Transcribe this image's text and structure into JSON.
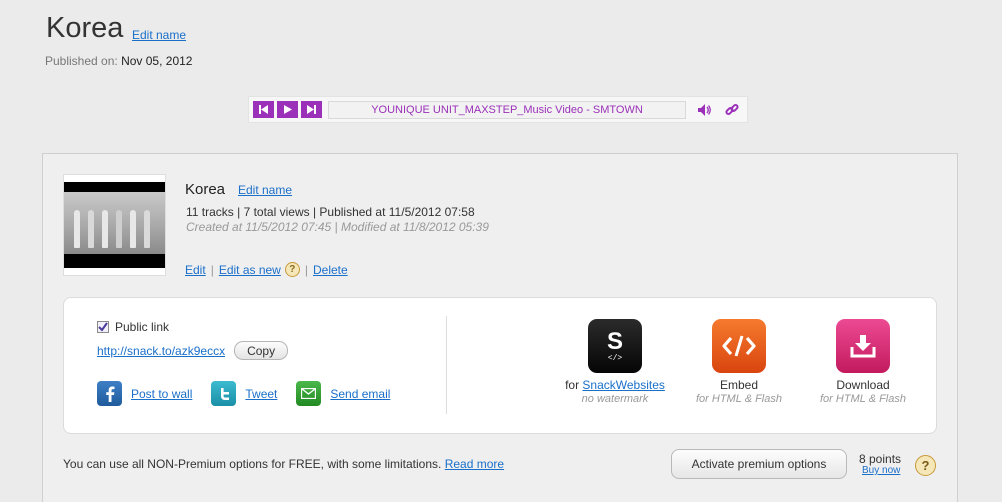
{
  "header": {
    "title": "Korea",
    "edit_name": "Edit name",
    "published_label": "Published on:",
    "published_date": "Nov 05, 2012"
  },
  "player": {
    "track_title": "YOUNIQUE UNIT_MAXSTEP_Music Video - SMTOWN",
    "accent": "#9b30b9"
  },
  "item": {
    "title": "Korea",
    "edit_name": "Edit name",
    "stats": "11 tracks | 7 total views | Published at 11/5/2012 07:58",
    "dates": "Created at 11/5/2012 07:45 | Modified at 11/8/2012 05:39",
    "actions": {
      "edit": "Edit",
      "edit_as_new": "Edit as new",
      "help": "?",
      "delete": "Delete",
      "separator": "|"
    }
  },
  "share": {
    "public_link_label": "Public link",
    "public_link_checked": true,
    "url": "http://snack.to/azk9eccx",
    "copy_label": "Copy",
    "post_to_wall": "Post to wall",
    "tweet": "Tweet",
    "send_email": "Send email"
  },
  "exports": [
    {
      "icon": "snack-websites-icon",
      "prefix": "for ",
      "link": "SnackWebsites",
      "sub": "no watermark",
      "color": "#111111"
    },
    {
      "icon": "embed-icon",
      "label": "Embed",
      "sub": "for HTML & Flash",
      "color": "#e0531a"
    },
    {
      "icon": "download-icon",
      "label": "Download",
      "sub": "for HTML & Flash",
      "color": "#d6246e"
    }
  ],
  "footer": {
    "free_text": "You can use all NON-Premium options for FREE, with some limitations.",
    "read_more": "Read more",
    "activate_label": "Activate premium options",
    "points": "8 points",
    "buy_now": "Buy now",
    "help": "?"
  }
}
